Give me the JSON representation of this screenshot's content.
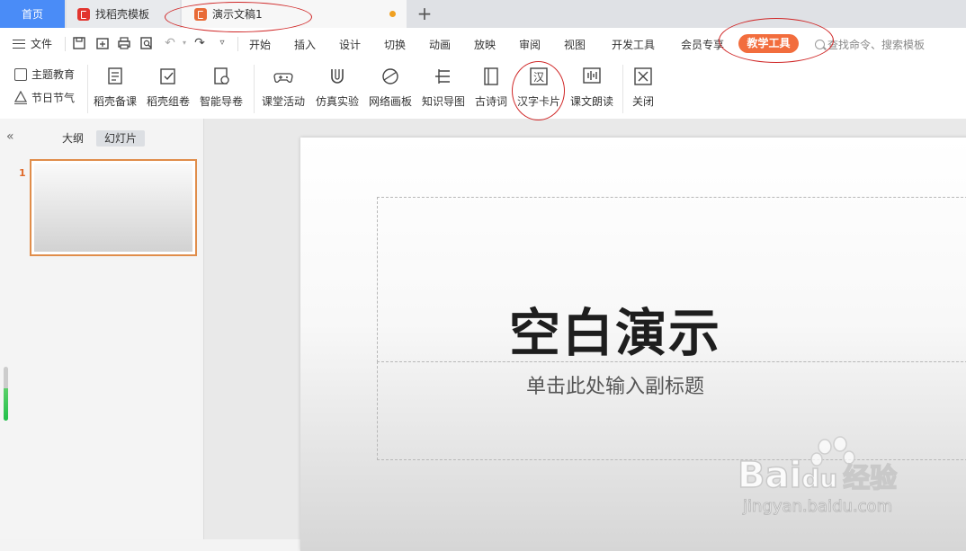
{
  "tabs": {
    "home": "首页",
    "templates": "找稻壳模板",
    "document": "演示文稿1",
    "new_tab": "+"
  },
  "menu": {
    "file": "文件",
    "items": [
      "开始",
      "插入",
      "设计",
      "切换",
      "动画",
      "放映",
      "审阅",
      "视图",
      "开发工具",
      "会员专享"
    ],
    "active": "教学工具",
    "search": "查找命令、搜索模板"
  },
  "ribbon": {
    "side": [
      "主题教育",
      "节日节气"
    ],
    "buttons": [
      "稻壳备课",
      "稻壳组卷",
      "智能导卷",
      "课堂活动",
      "仿真实验",
      "网络画板",
      "知识导图",
      "古诗词",
      "汉字卡片",
      "课文朗读",
      "关闭"
    ]
  },
  "panel": {
    "tab_outline": "大纲",
    "tab_slides": "幻灯片",
    "slide_number": "1"
  },
  "slide": {
    "title": "空白演示",
    "subtitle": "单击此处输入副标题"
  },
  "watermark": {
    "brand": "Bai",
    "brand_suffix": "du",
    "brand_cn": "经验",
    "url": "jingyan.baidu.com"
  },
  "colors": {
    "home_tab": "#4a8cf7",
    "active_menu": "#f26d3d",
    "annotation": "#d02828",
    "thumb_border": "#e08d4a"
  }
}
